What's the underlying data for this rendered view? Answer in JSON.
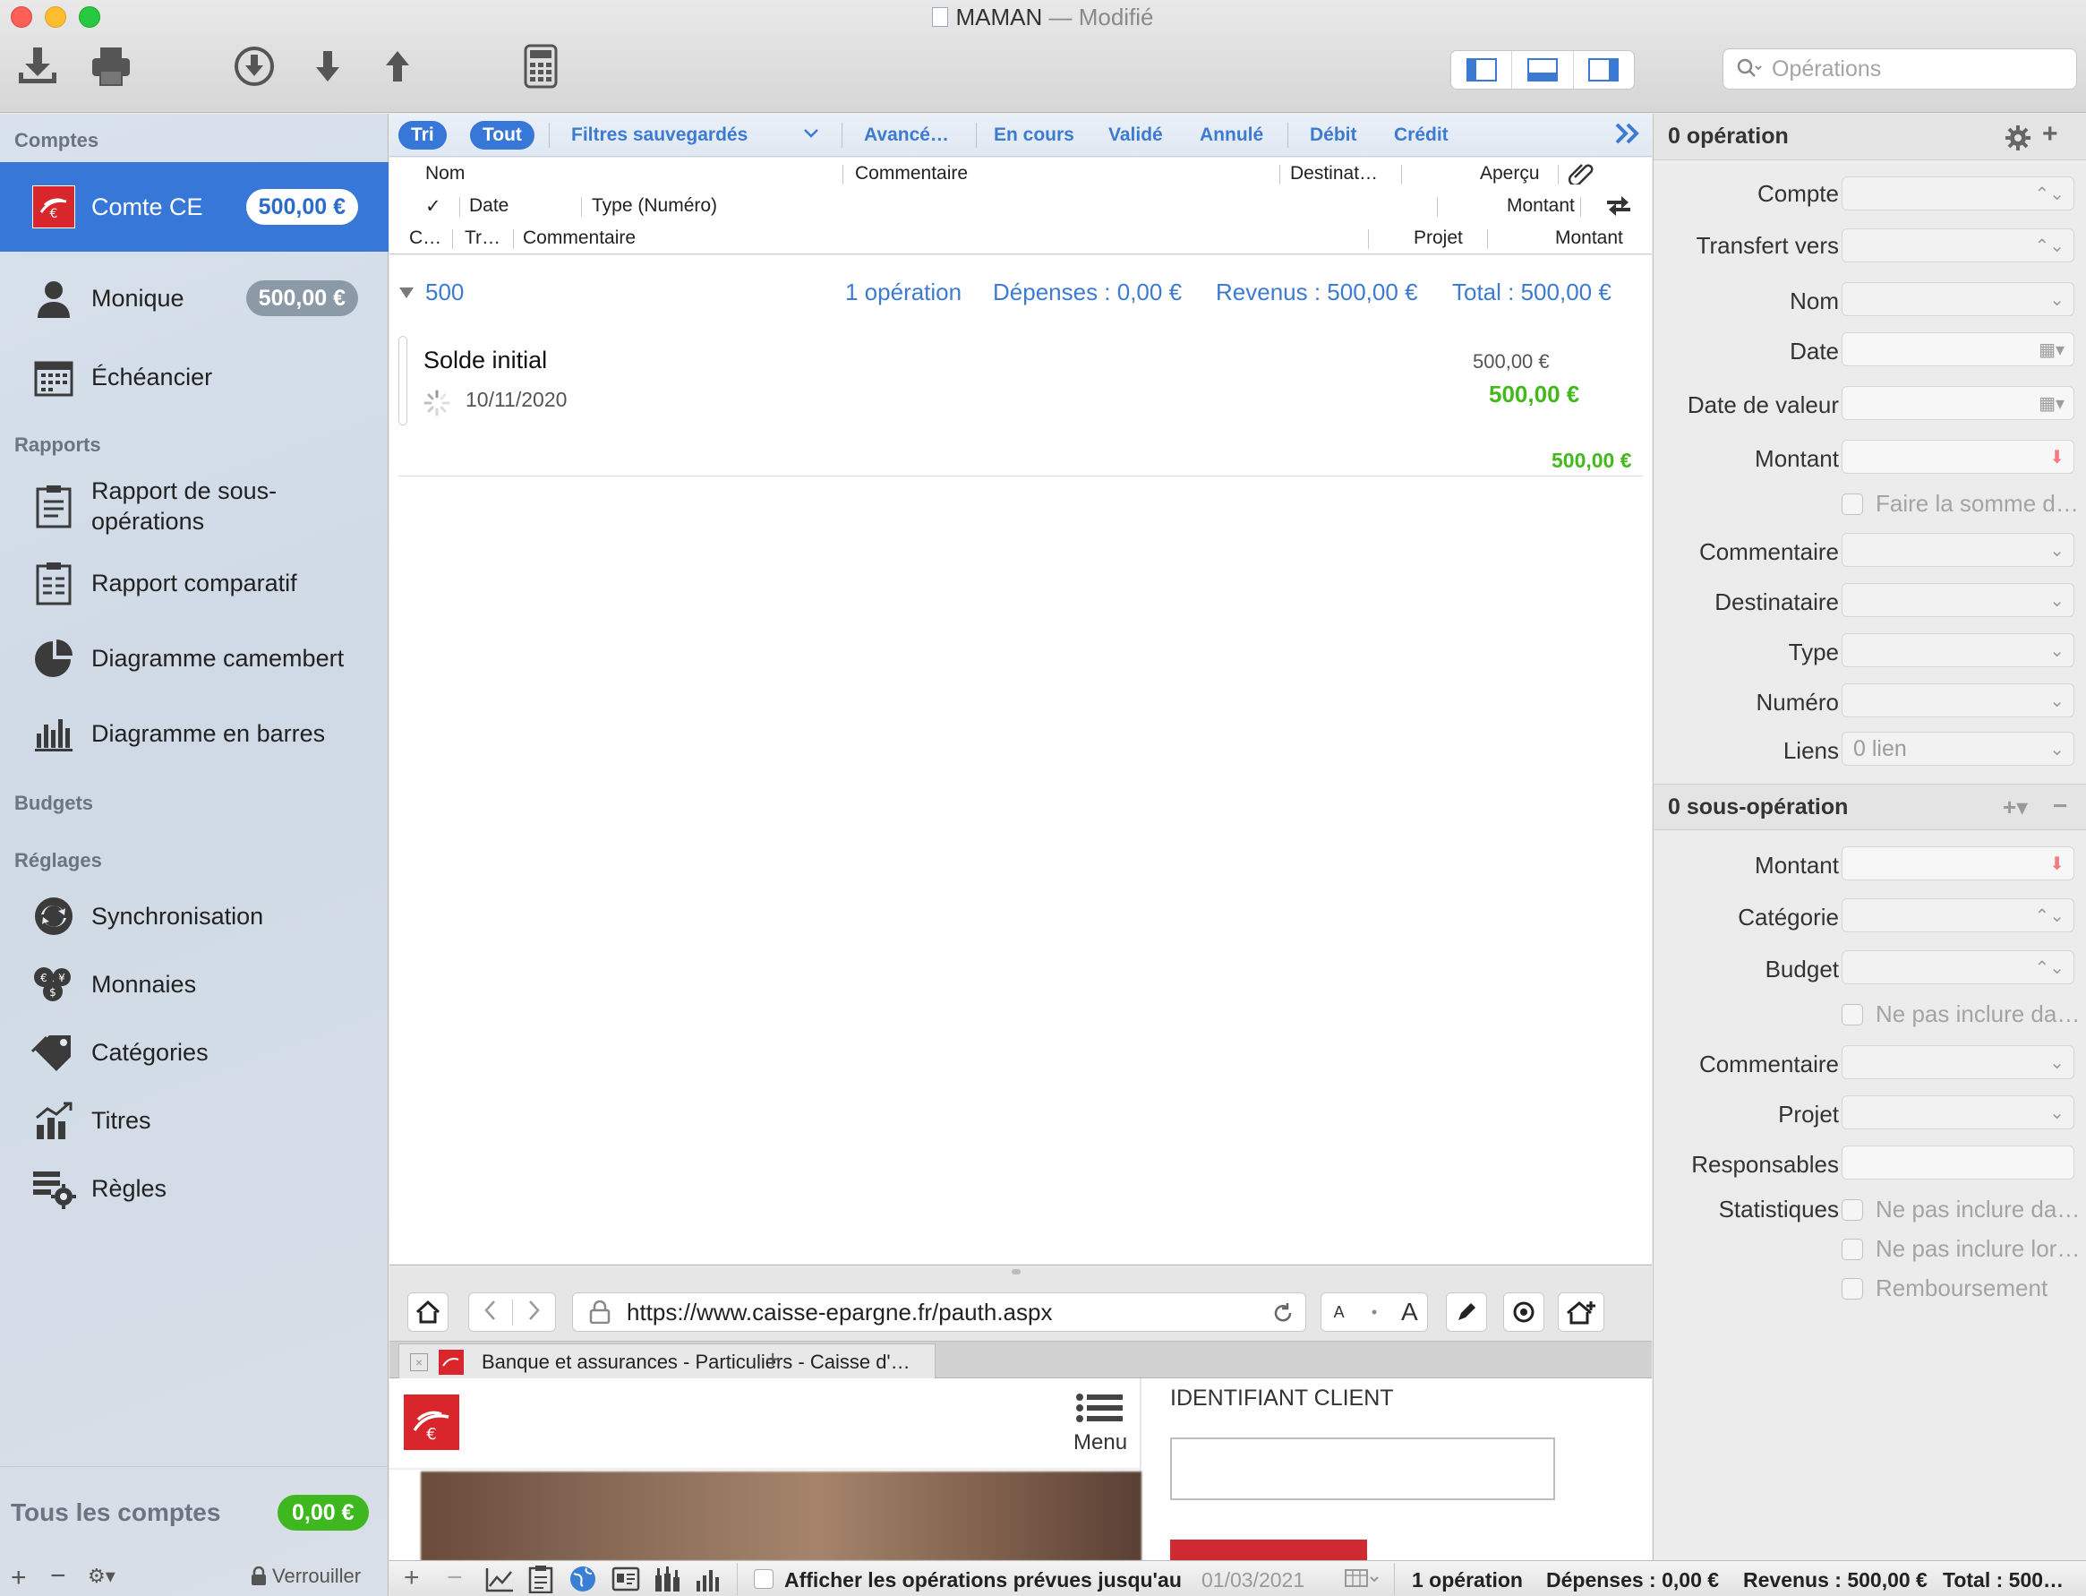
{
  "window": {
    "title": "MAMAN",
    "modified": " — Modifié"
  },
  "toolbar": {
    "search_placeholder": "Opérations"
  },
  "sidebar": {
    "sections": {
      "comptes": "Comptes",
      "rapports": "Rapports",
      "budgets": "Budgets",
      "reglages": "Réglages"
    },
    "accounts": [
      {
        "label": "Comte CE",
        "balance": "500,00 €"
      },
      {
        "label": "Monique",
        "balance": "500,00 €"
      }
    ],
    "echeancier": "Échéancier",
    "reports": [
      {
        "label": "Rapport de sous-opérations"
      },
      {
        "label": "Rapport comparatif"
      },
      {
        "label": "Diagramme camembert"
      },
      {
        "label": "Diagramme en barres"
      }
    ],
    "settings": [
      {
        "label": "Synchronisation"
      },
      {
        "label": "Monnaies"
      },
      {
        "label": "Catégories"
      },
      {
        "label": "Titres"
      },
      {
        "label": "Règles"
      }
    ],
    "all_accounts": {
      "label": "Tous les comptes",
      "balance": "0,00 €"
    },
    "lock_label": "Verrouiller"
  },
  "filters": {
    "tri": "Tri",
    "tout": "Tout",
    "saved": "Filtres sauvegardés",
    "advanced": "Avancé…",
    "en_cours": "En cours",
    "valide": "Validé",
    "annule": "Annulé",
    "debit": "Débit",
    "credit": "Crédit"
  },
  "columns": {
    "nom": "Nom",
    "commentaire1": "Commentaire",
    "destinataire": "Destinat…",
    "apercu": "Aperçu",
    "check": "✓",
    "date": "Date",
    "type": "Type (Numéro)",
    "montant1": "Montant",
    "c": "C…",
    "tr": "Tr…",
    "commentaire2": "Commentaire",
    "projet": "Projet",
    "montant2": "Montant"
  },
  "group": {
    "name": "500",
    "count": "1 opération",
    "depenses": "Dépenses : 0,00 €",
    "revenus": "Revenus : 500,00 €",
    "total": "Total : 500,00 €"
  },
  "transaction": {
    "name": "Solde initial",
    "date": "10/11/2020",
    "amount": "500,00 €",
    "balance": "500,00 €",
    "footer_total": "500,00 €"
  },
  "browser": {
    "url": "https://www.caisse-epargne.fr/pauth.aspx",
    "tab_title": "Banque et assurances - Particuliers - Caisse d'…",
    "menu_label": "Menu",
    "login_label": "IDENTIFIANT CLIENT"
  },
  "statusbar": {
    "show_label": "Afficher les opérations prévues jusqu'au",
    "date": "01/03/2021",
    "count": "1 opération",
    "depenses": "Dépenses : 0,00 €",
    "revenus": "Revenus : 500,00 €",
    "total": "Total : 500…"
  },
  "inspector": {
    "operation_header": "0 opération",
    "fields": {
      "compte": "Compte",
      "transfert": "Transfert vers",
      "nom": "Nom",
      "date": "Date",
      "date_valeur": "Date de valeur",
      "montant": "Montant",
      "faire_somme": "Faire la somme d…",
      "commentaire": "Commentaire",
      "destinataire": "Destinataire",
      "type": "Type",
      "numero": "Numéro",
      "liens": "Liens",
      "liens_value": "0 lien"
    },
    "sub_header": "0 sous-opération",
    "sub_fields": {
      "montant": "Montant",
      "categorie": "Catégorie",
      "budget": "Budget",
      "ne_pas_inclure_1": "Ne pas inclure da…",
      "commentaire": "Commentaire",
      "projet": "Projet",
      "responsables": "Responsables",
      "statistiques": "Statistiques",
      "ne_pas_inclure_2": "Ne pas inclure da…",
      "ne_pas_inclure_3": "Ne pas inclure lor…",
      "remboursement": "Remboursement"
    }
  }
}
